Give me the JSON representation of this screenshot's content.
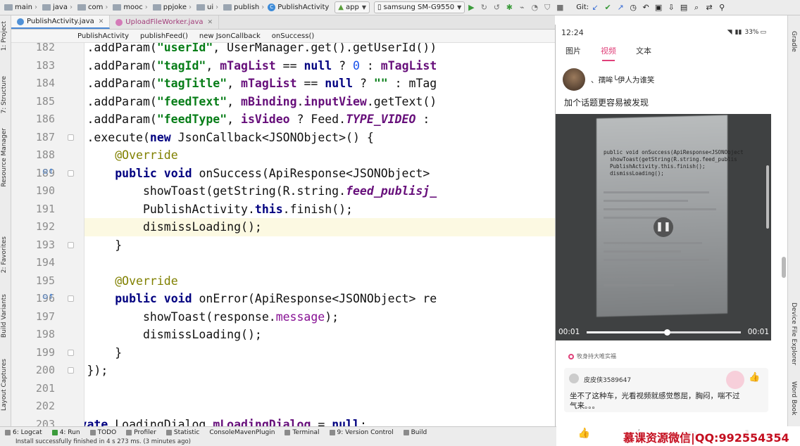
{
  "toolbar": {
    "crumbs": [
      "main",
      "java",
      "com",
      "mooc",
      "ppjoke",
      "ui",
      "publish"
    ],
    "class_name": "PublishActivity",
    "config": "app",
    "device": "samsung SM-G9550",
    "git_label": "Git:"
  },
  "tabs": [
    {
      "label": "PublishActivity.java",
      "active": true
    },
    {
      "label": "UploadFileWorker.java",
      "active": false
    }
  ],
  "breadcrumb": [
    "PublishActivity",
    "publishFeed()",
    "new JsonCallback",
    "onSuccess()"
  ],
  "left_tools": [
    "1: Project",
    "7: Structure",
    "Resource Manager",
    "2: Favorites",
    "Build Variants",
    "Layout Captures"
  ],
  "right_tools": [
    "Gradle",
    "Device File Explorer",
    "Word Book"
  ],
  "line_numbers": [
    "182",
    "183",
    "184",
    "185",
    "186",
    "187",
    "188",
    "189",
    "190",
    "191",
    "192",
    "193",
    "194",
    "195",
    "196",
    "197",
    "198",
    "199",
    "200",
    "201",
    "202",
    "203"
  ],
  "code_lines": [
    "        .addParam(\"userId\", UserManager.get().getUserId())",
    "        .addParam(\"tagId\", mTagList == null ? 0 : mTagList",
    "        .addParam(\"tagTitle\", mTagList == null ? \"\" : mTag",
    "        .addParam(\"feedText\", mBinding.inputView.getText()",
    "        .addParam(\"feedType\", isVideo ? Feed.TYPE_VIDEO :",
    "        .execute(new JsonCallback<JSONObject>() {",
    "            @Override",
    "            public void onSuccess(ApiResponse<JSONObject>",
    "                showToast(getString(R.string.feed_publisj_",
    "                PublishActivity.this.finish();",
    "                dismissLoading();",
    "            }",
    "",
    "            @Override",
    "            public void onError(ApiResponse<JSONObject> re",
    "                showToast(response.message);",
    "                dismissLoading();",
    "            }",
    "        });",
    "    }",
    "",
    "    private LoadingDialog mLoadingDialog = null;"
  ],
  "phone": {
    "time": "12:24",
    "battery": "33%",
    "tabs": [
      "图片",
      "视频",
      "文本"
    ],
    "active_tab": "视频",
    "author": "、孺哞╰伊人为谁笑",
    "feed_text": "加个话题更容易被发现",
    "video": {
      "elapsed": "00:01",
      "duration": "00:01",
      "progress": 0.52
    },
    "tag": "牧身持大唯实福",
    "comment": {
      "user": "皮皮侠3589647",
      "text": "坐不了这种车，光看视频就感觉憋屈，胸闷，喘不过气来。。。"
    }
  },
  "bottom_tools": [
    "6: Logcat",
    "4: Run",
    "TODO",
    "Profiler",
    "Statistic",
    "ConsoleMavenPlugin",
    "Terminal",
    "9: Version Control",
    "Build"
  ],
  "status_text": "Install successfully finished in 4 s 273 ms. (3 minutes ago)",
  "watermark": "慕课资源微信|QQ:992554354",
  "colors": {
    "accent": "#e0417a",
    "keyword": "#000080",
    "string": "#067d17",
    "annotation": "#808000"
  }
}
